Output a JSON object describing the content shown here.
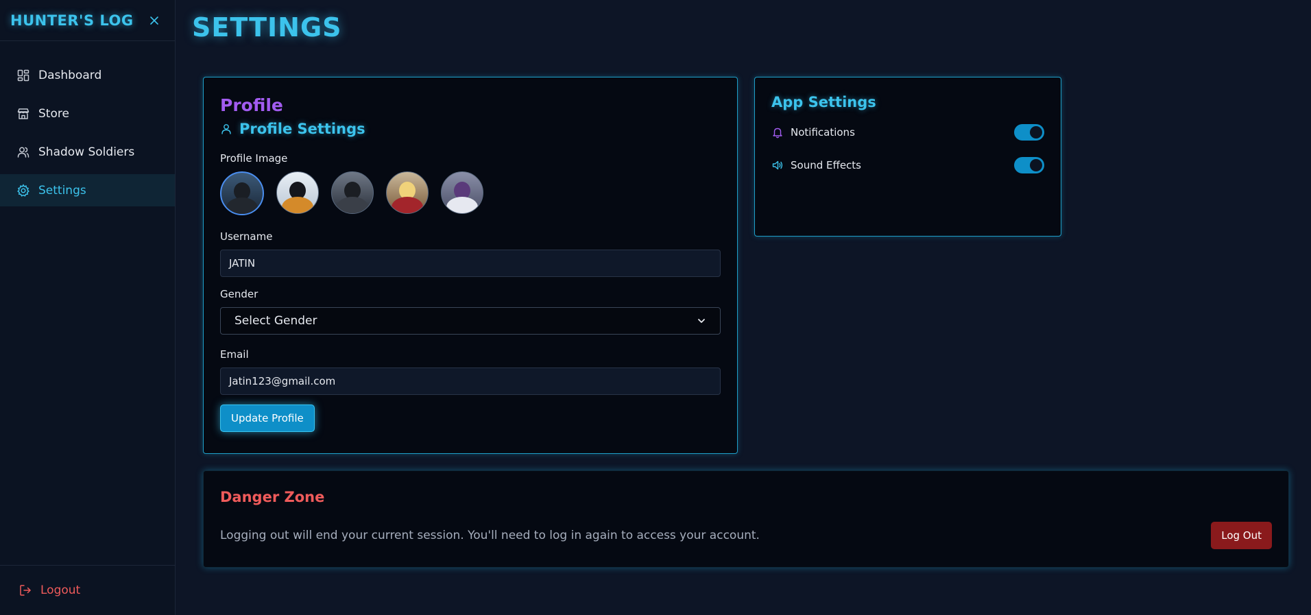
{
  "sidebar": {
    "brand": "HUNTER'S LOG",
    "items": [
      {
        "label": "Dashboard",
        "icon": "grid-icon",
        "active": false
      },
      {
        "label": "Store",
        "icon": "store-icon",
        "active": false
      },
      {
        "label": "Shadow Soldiers",
        "icon": "users-icon",
        "active": false
      },
      {
        "label": "Settings",
        "icon": "gear-icon",
        "active": true
      }
    ],
    "logout_label": "Logout"
  },
  "page": {
    "title": "SETTINGS"
  },
  "profile": {
    "heading": "Profile",
    "subheading": "Profile Settings",
    "image_label": "Profile Image",
    "username_label": "Username",
    "username_value": "JATIN",
    "gender_label": "Gender",
    "gender_value": "Select Gender",
    "email_label": "Email",
    "email_value": "Jatin123@gmail.com",
    "update_button": "Update Profile"
  },
  "app_settings": {
    "heading": "App Settings",
    "notifications_label": "Notifications",
    "notifications_on": true,
    "sound_label": "Sound Effects",
    "sound_on": true
  },
  "danger": {
    "heading": "Danger Zone",
    "text": "Logging out will end your current session. You'll need to log in again to access your account.",
    "button": "Log Out"
  },
  "colors": {
    "accent": "#3cc3ec",
    "purple": "#a25cf0",
    "danger": "#ef5b5b",
    "toggle_on": "#0e8fc8"
  }
}
